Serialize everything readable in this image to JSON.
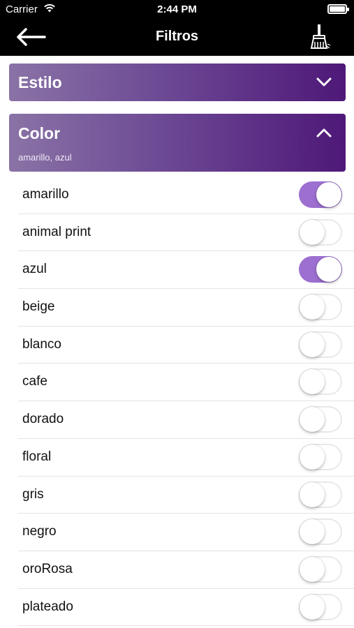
{
  "status_bar": {
    "carrier": "Carrier",
    "time": "2:44 PM"
  },
  "nav": {
    "title": "Filtros",
    "back_icon": "arrow-left-icon",
    "clear_icon": "broom-icon"
  },
  "sections": {
    "estilo": {
      "label": "Estilo",
      "expanded": false
    },
    "color": {
      "label": "Color",
      "selected_summary": "amarillo, azul",
      "expanded": true
    }
  },
  "colors": {
    "accent": "#9c6fd0",
    "header_gradient": [
      "#8a73a6",
      "#4e1878"
    ]
  },
  "color_options": [
    {
      "label": "amarillo",
      "on": true
    },
    {
      "label": "animal print",
      "on": false
    },
    {
      "label": "azul",
      "on": true
    },
    {
      "label": "beige",
      "on": false
    },
    {
      "label": "blanco",
      "on": false
    },
    {
      "label": "cafe",
      "on": false
    },
    {
      "label": "dorado",
      "on": false
    },
    {
      "label": "floral",
      "on": false
    },
    {
      "label": "gris",
      "on": false
    },
    {
      "label": "negro",
      "on": false
    },
    {
      "label": "oroRosa",
      "on": false
    },
    {
      "label": "plateado",
      "on": false
    }
  ]
}
